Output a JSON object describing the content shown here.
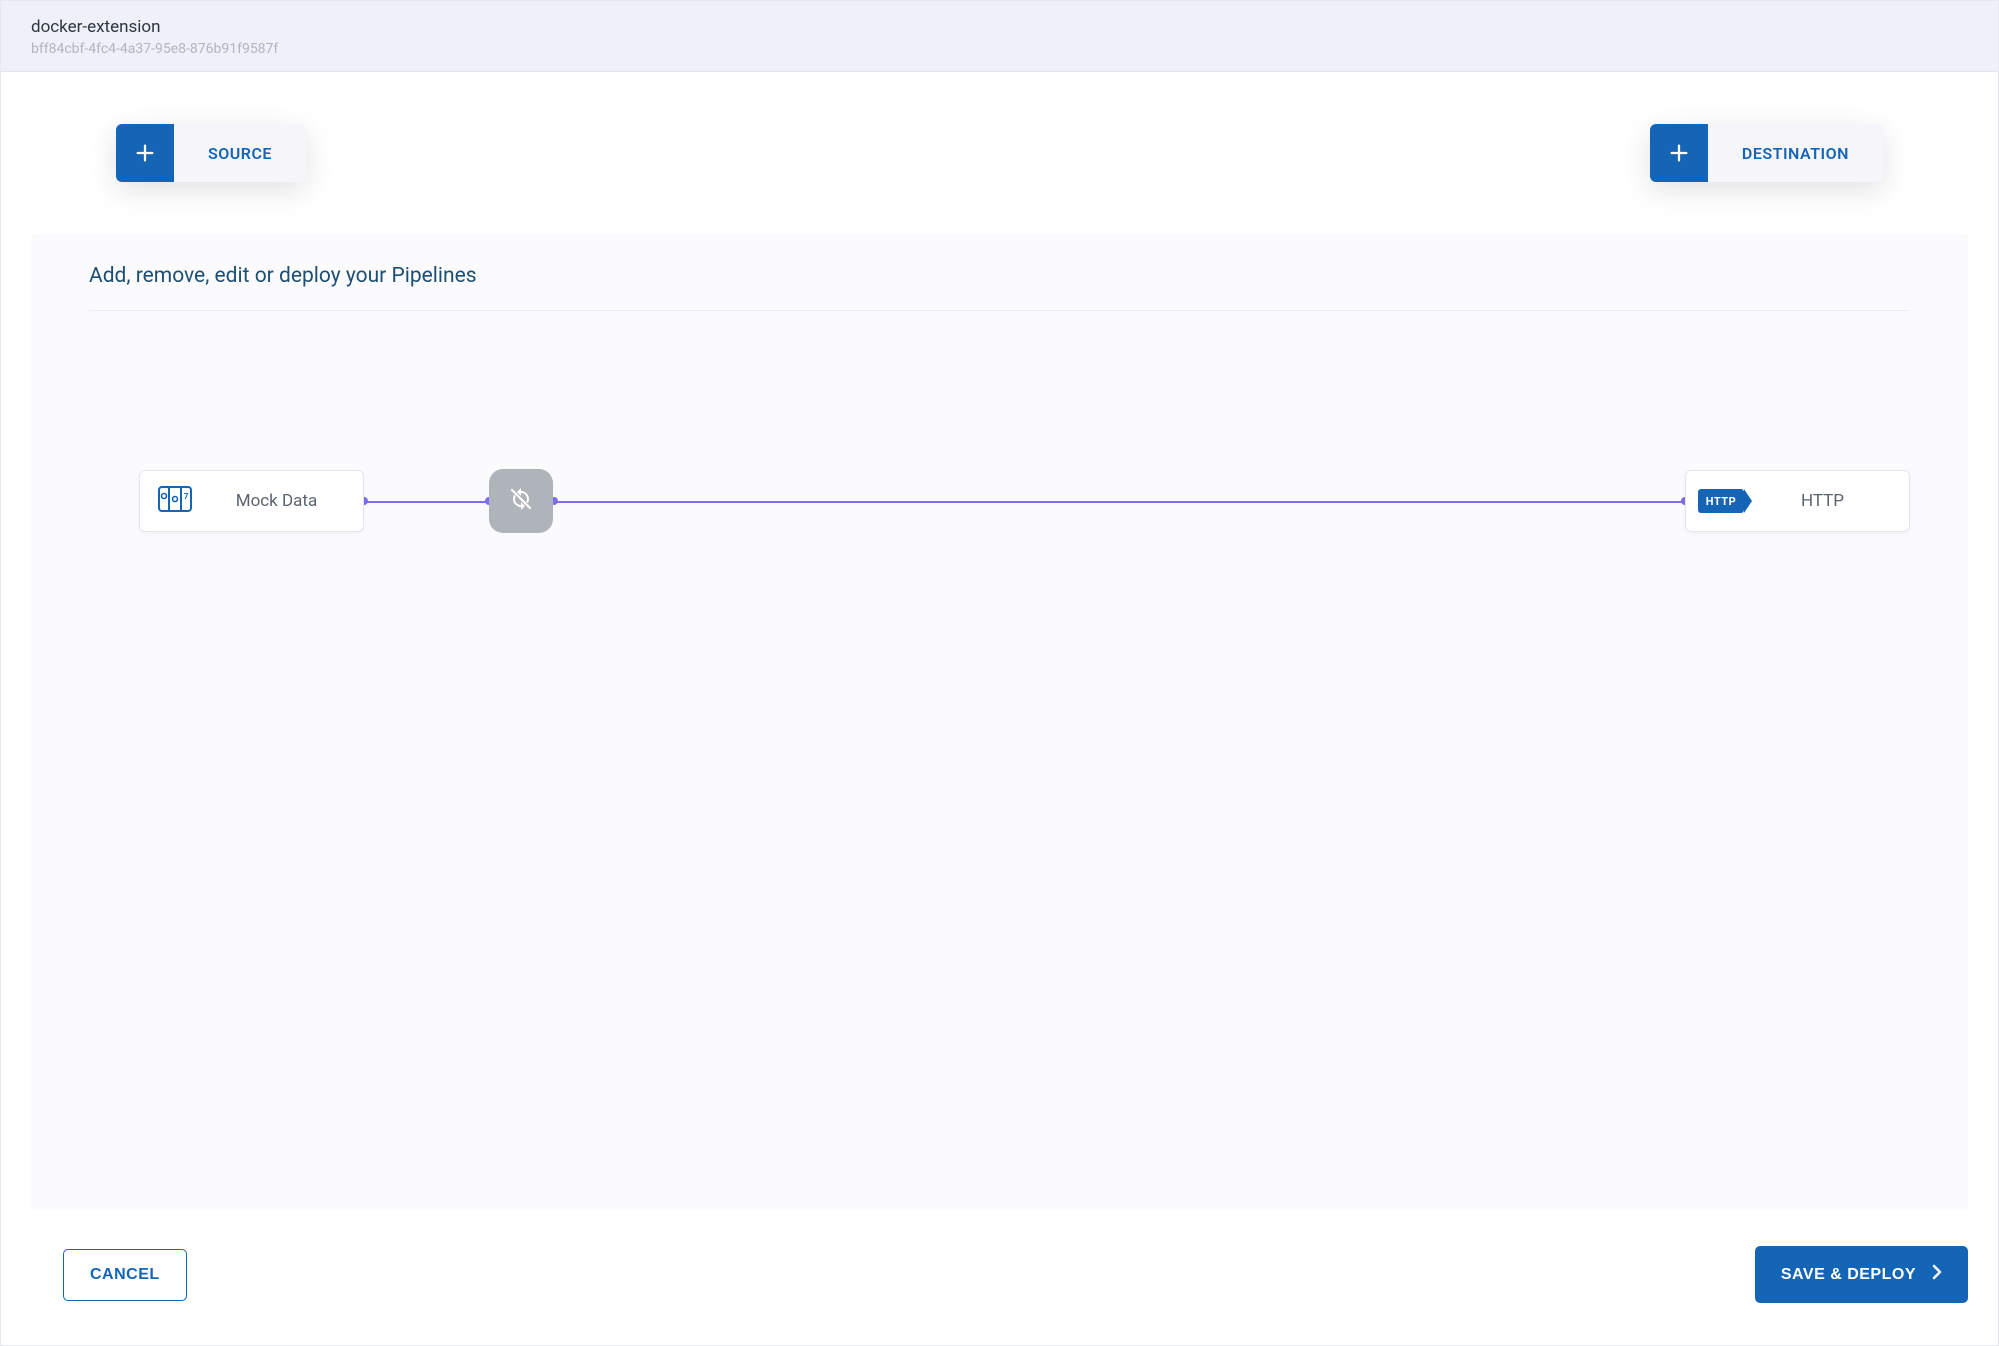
{
  "header": {
    "title": "docker-extension",
    "subtitle": "bff84cbf-4fc4-4a37-95e8-876b91f9587f"
  },
  "toolbar": {
    "source_label": "SOURCE",
    "destination_label": "DESTINATION"
  },
  "panel": {
    "title": "Add, remove, edit or deploy your Pipelines"
  },
  "pipeline": {
    "source_node_label": "Mock Data",
    "destination_node_label": "HTTP",
    "destination_badge": "HTTP"
  },
  "footer": {
    "cancel_label": "CANCEL",
    "save_label": "SAVE & DEPLOY"
  }
}
